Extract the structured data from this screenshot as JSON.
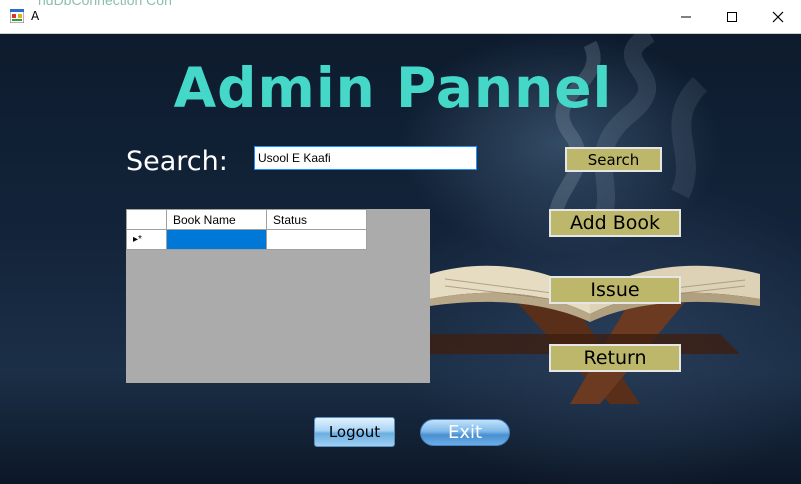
{
  "window": {
    "title": "A",
    "background_text": "ndDbConnection Con"
  },
  "heading": "Admin Pannel",
  "search": {
    "label": "Search:",
    "value": "Usool E Kaafi",
    "button": "Search"
  },
  "actions": {
    "add_book": "Add Book",
    "issue": "Issue",
    "return": "Return"
  },
  "grid": {
    "columns": [
      "Book Name",
      "Status"
    ],
    "new_row_marker": "▸*"
  },
  "footer": {
    "logout": "Logout",
    "exit": "Exit"
  },
  "colors": {
    "heading": "#45d7c8",
    "button_fill": "#bdb76b",
    "grid_background": "#ababab",
    "selection": "#0078d7"
  }
}
